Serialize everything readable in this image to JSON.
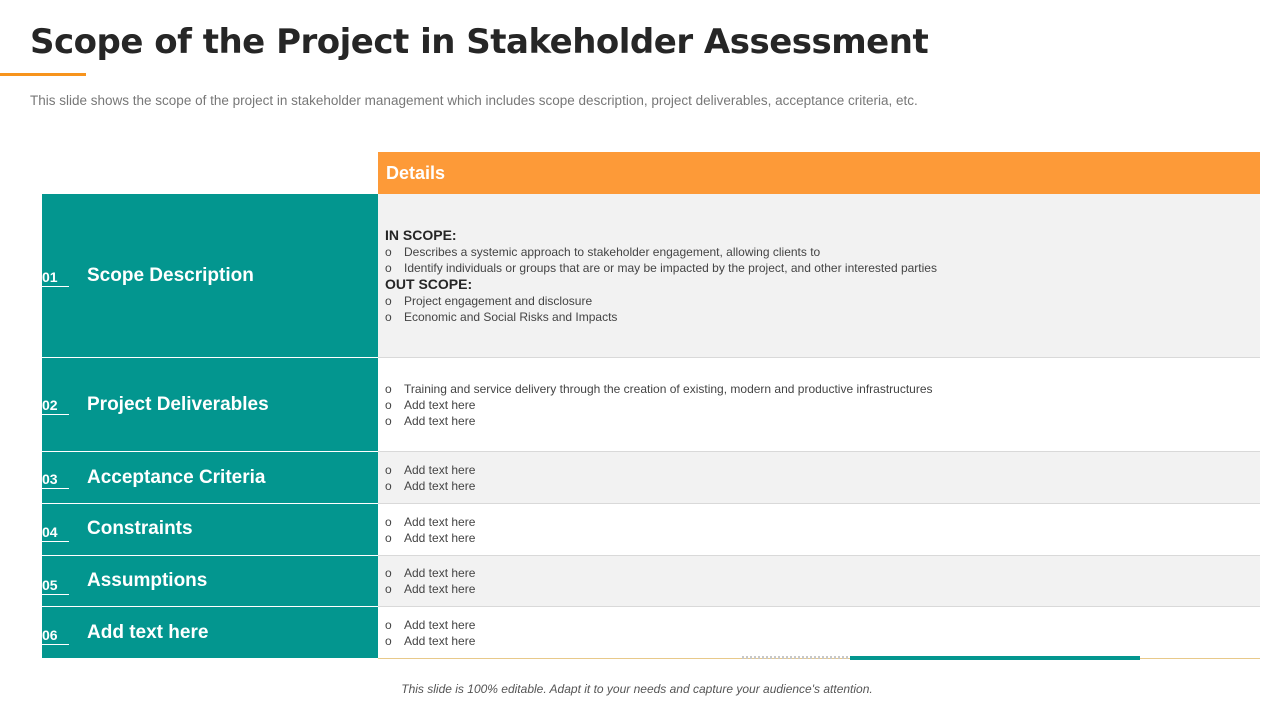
{
  "title": "Scope of the Project in Stakeholder Assessment",
  "subtitle": "This slide shows the scope of the project in stakeholder management which includes scope description, project deliverables, acceptance criteria, etc.",
  "table": {
    "header": "Details",
    "rows": [
      {
        "num": "01",
        "label": "Scope Description",
        "in_scope_heading": "IN SCOPE:",
        "in_scope_bullets": [
          "Describes a systemic approach to stakeholder engagement, allowing clients to",
          "Identify individuals or groups that are or may be impacted by the project, and other interested parties"
        ],
        "out_scope_heading": "OUT SCOPE:",
        "out_scope_bullets": [
          "Project engagement and disclosure",
          "Economic and Social Risks and Impacts"
        ]
      },
      {
        "num": "02",
        "label": "Project Deliverables",
        "bullets": [
          "Training and service delivery through the creation of existing, modern and productive infrastructures",
          "Add text here",
          "Add text here"
        ]
      },
      {
        "num": "03",
        "label": "Acceptance Criteria",
        "bullets": [
          "Add text here",
          "Add text here"
        ]
      },
      {
        "num": "04",
        "label": "Constraints",
        "bullets": [
          "Add text here",
          "Add text here"
        ]
      },
      {
        "num": "05",
        "label": "Assumptions",
        "bullets": [
          "Add text here",
          "Add text here"
        ]
      },
      {
        "num": "06",
        "label": "Add text here",
        "bullets": [
          "Add text here",
          "Add text here"
        ]
      }
    ]
  },
  "bullet_marker": "o",
  "footer": "This slide is 100% editable. Adapt it to your needs and capture your audience's attention.",
  "colors": {
    "accent_orange": "#f7941d",
    "header_orange": "#fd9a38",
    "teal": "#03968f",
    "row_shade": "#f2f2f2"
  }
}
